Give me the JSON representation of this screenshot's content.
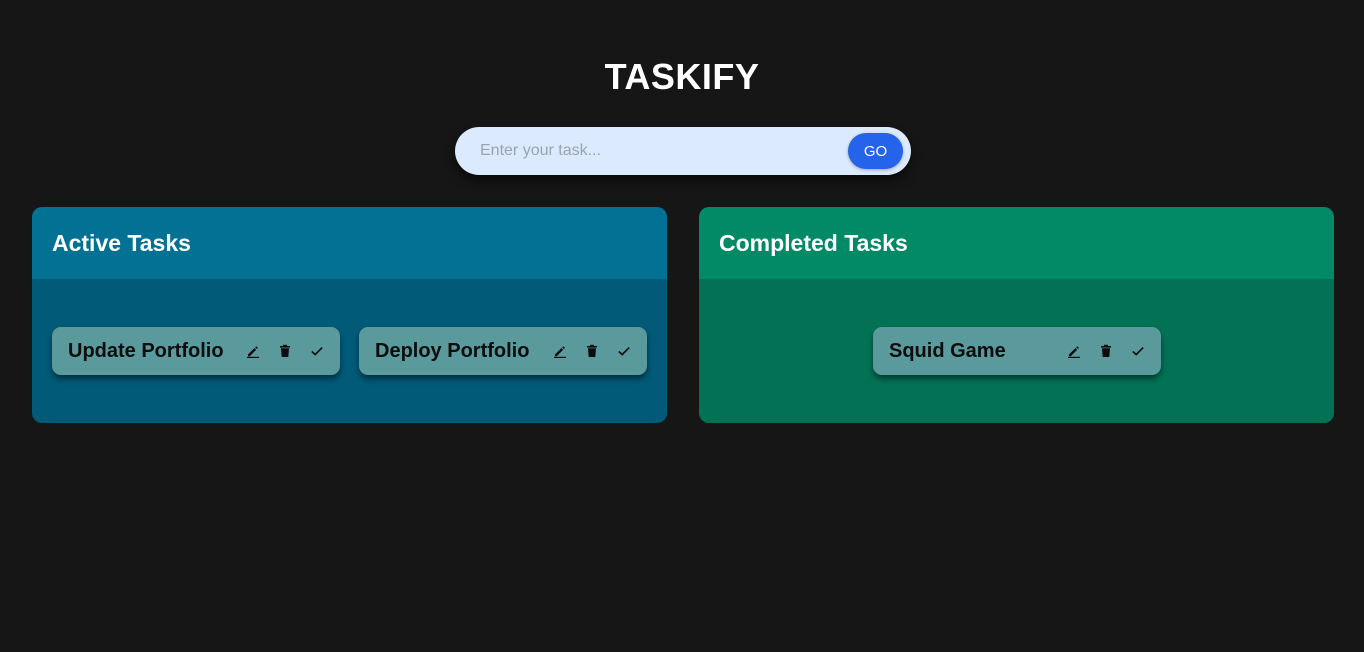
{
  "app": {
    "title": "TASKIFY"
  },
  "form": {
    "placeholder": "Enter your task...",
    "value": "",
    "go_label": "GO"
  },
  "active": {
    "heading": "Active Tasks",
    "tasks": [
      {
        "label": "Update Portfolio"
      },
      {
        "label": "Deploy Portfolio"
      }
    ]
  },
  "completed": {
    "heading": "Completed Tasks",
    "tasks": [
      {
        "label": "Squid Game"
      }
    ]
  },
  "icons": {
    "edit": "pencil-icon",
    "delete": "trash-icon",
    "done": "check-icon"
  },
  "colors": {
    "background": "#161616",
    "input_bg": "#dbeafe",
    "go_button": "#2563eb",
    "active_header": "#027194",
    "active_body": "#015a78",
    "completed_header": "#028a66",
    "completed_body": "#037254",
    "card": "#5a9a9c"
  }
}
